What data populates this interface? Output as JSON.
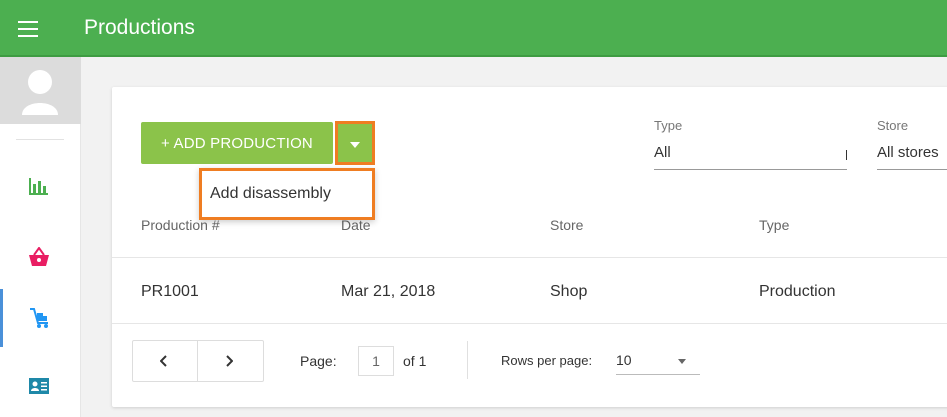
{
  "app": {
    "title": "Productions"
  },
  "toolbar": {
    "add_label": "+ ADD PRODUCTION",
    "dropdown_item": "Add disassembly"
  },
  "filters": {
    "type": {
      "label": "Type",
      "value": "All"
    },
    "store": {
      "label": "Store",
      "value": "All stores"
    }
  },
  "table": {
    "headers": [
      "Production #",
      "Date",
      "Store",
      "Type"
    ],
    "rows": [
      {
        "number": "PR1001",
        "date": "Mar 21, 2018",
        "store": "Shop",
        "type": "Production"
      }
    ]
  },
  "pagination": {
    "page_label": "Page:",
    "page_value": "1",
    "of_label": "of 1",
    "rows_label": "Rows per page:",
    "rows_value": "10"
  },
  "colors": {
    "header": "#4caf50",
    "button": "#8bc34a",
    "highlight": "#ef7d22",
    "active_nav": "#4a90d9"
  },
  "sidebar": {
    "items": [
      "reports-icon",
      "basket-icon",
      "productions-icon",
      "contacts-icon"
    ]
  }
}
